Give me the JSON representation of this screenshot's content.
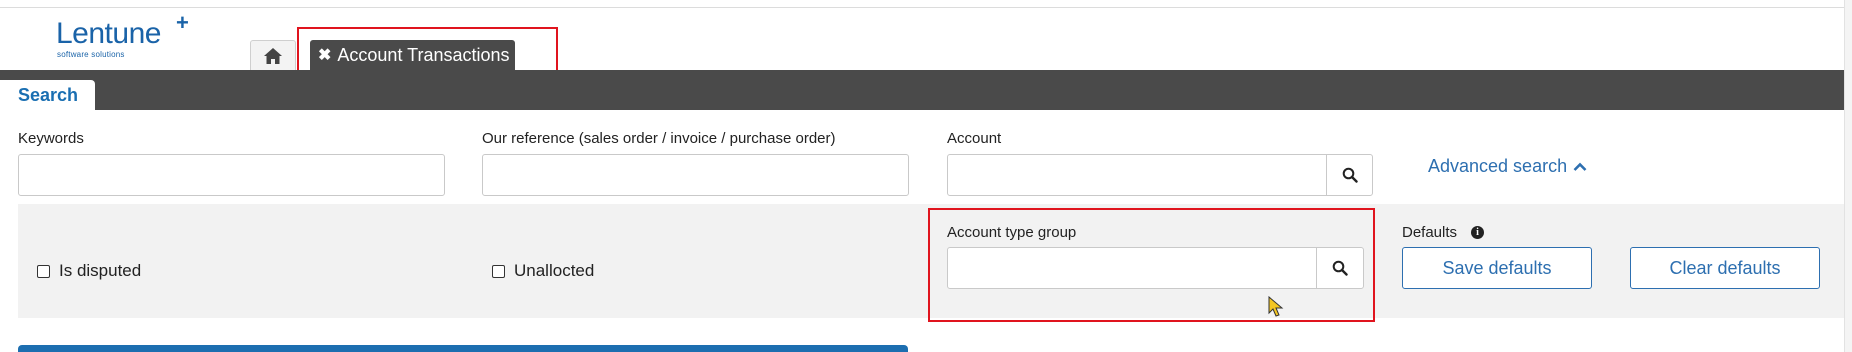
{
  "logo": {
    "name": "Lentune",
    "plus": "+",
    "tagline": "software solutions"
  },
  "tabs": {
    "home_icon": "home-icon",
    "active_close": "✖",
    "active_label": "Account Transactions"
  },
  "search_tab": {
    "label": "Search"
  },
  "fields": {
    "keywords_label": "Keywords",
    "keywords_value": "",
    "our_reference_label": "Our reference (sales order / invoice / purchase order)",
    "our_reference_value": "",
    "account_label": "Account",
    "account_value": "",
    "account_type_group_label": "Account type group",
    "account_type_group_value": ""
  },
  "advanced_search": {
    "label": "Advanced search",
    "icon": "chevron-up-icon"
  },
  "checkboxes": {
    "is_disputed": {
      "label": "Is disputed",
      "checked": false
    },
    "unallocated": {
      "label": "Unallocted",
      "checked": false
    }
  },
  "defaults": {
    "label": "Defaults",
    "info_glyph": "i",
    "save_label": "Save defaults",
    "clear_label": "Clear defaults"
  },
  "colors": {
    "accent": "#2d6fb0",
    "dark_bar": "#4a4a4a",
    "highlight": "#e0141e",
    "grey_band": "#f2f2f2"
  }
}
